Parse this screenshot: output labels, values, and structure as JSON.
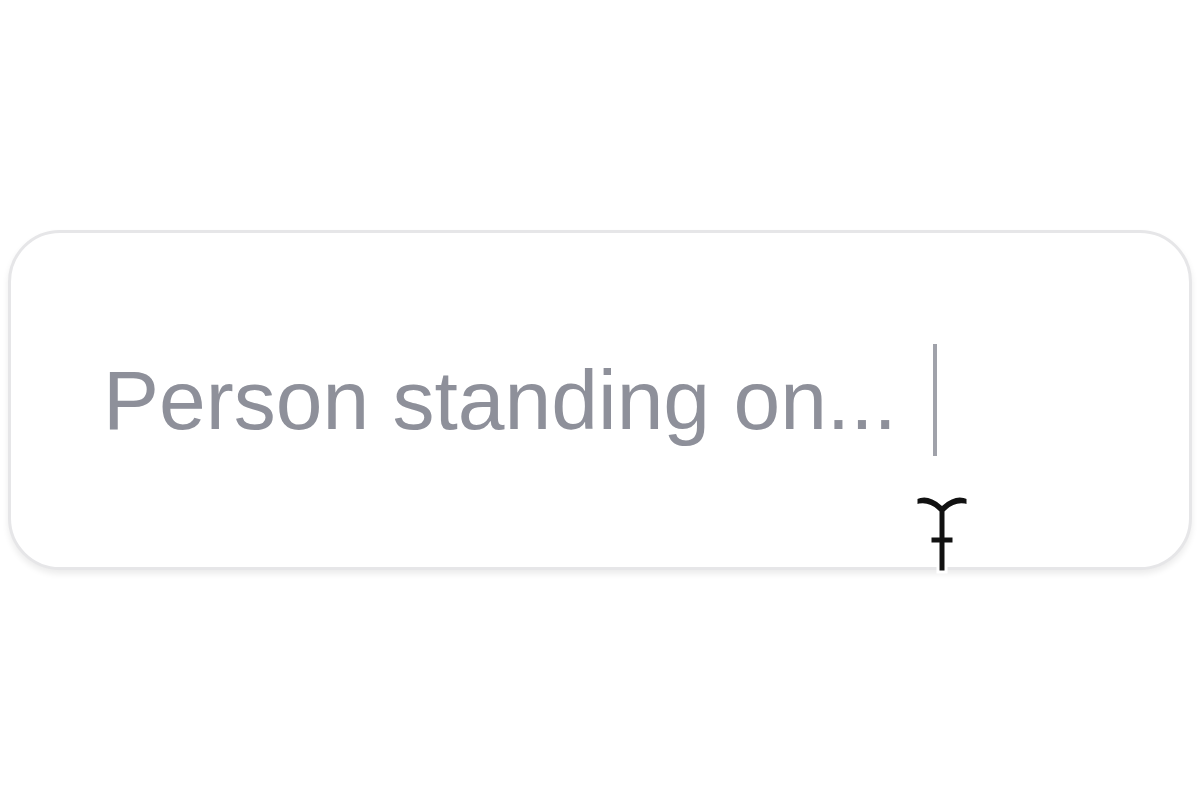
{
  "search_field": {
    "placeholder": "Person standing on...",
    "focused": true
  }
}
